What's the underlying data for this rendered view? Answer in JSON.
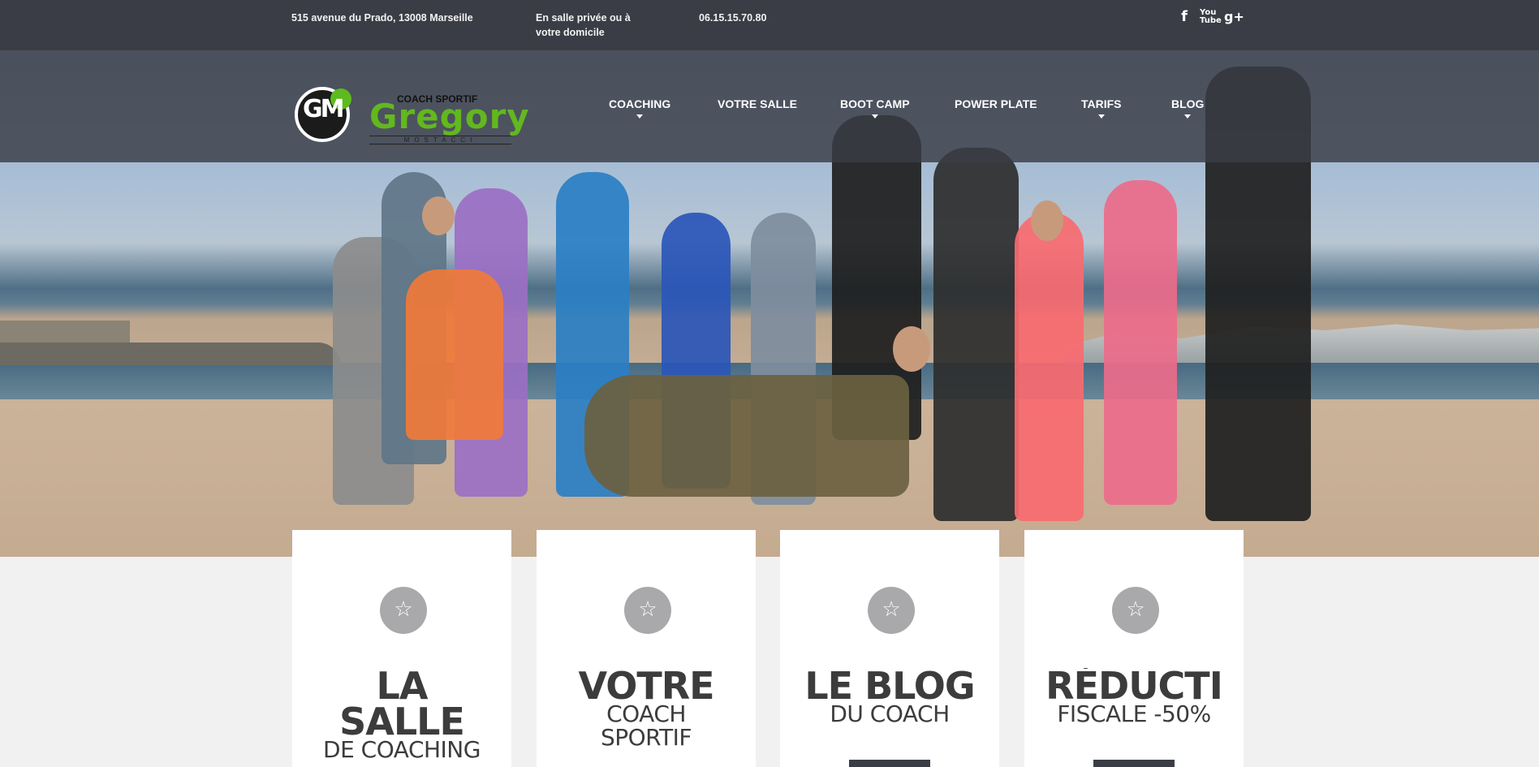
{
  "topbar": {
    "address": "515 avenue du Prado, 13008 Marseille",
    "salle": "En salle privée ou à votre domicile",
    "phone": "06.15.15.70.80",
    "social": {
      "facebook": "f",
      "youtube": "You\nTube",
      "googleplus": "g+"
    }
  },
  "logo": {
    "small": "COACH SPORTIF",
    "name": "Gregory",
    "sub": "MOSTACCI",
    "monogram": "GM"
  },
  "nav": {
    "items": [
      {
        "label": "COACHING",
        "has_dropdown": true
      },
      {
        "label": "VOTRE SALLE",
        "has_dropdown": false
      },
      {
        "label": "BOOT CAMP",
        "has_dropdown": true
      },
      {
        "label": "POWER PLATE",
        "has_dropdown": false
      },
      {
        "label": "TARIFS",
        "has_dropdown": true
      },
      {
        "label": "BLOG",
        "has_dropdown": true
      }
    ]
  },
  "cards": [
    {
      "title_1": "LA",
      "title_2": "SALLE",
      "subtitle": "DE COACHING"
    },
    {
      "title_1": "VOTRE",
      "subtitle_1": "COACH",
      "subtitle_2": "SPORTIF"
    },
    {
      "title_1": "LE BLOG",
      "subtitle_1": "DU COACH"
    },
    {
      "title_1": "RÉDUCTI",
      "subtitle_1": "FISCALE -50%"
    }
  ],
  "icons": {
    "card_icon": "star-icon"
  },
  "colors": {
    "topbar": "#3a3d45",
    "accent_green": "#62b81e",
    "card_text": "#3c3c3c",
    "icon_circle": "#a9a9ab"
  }
}
